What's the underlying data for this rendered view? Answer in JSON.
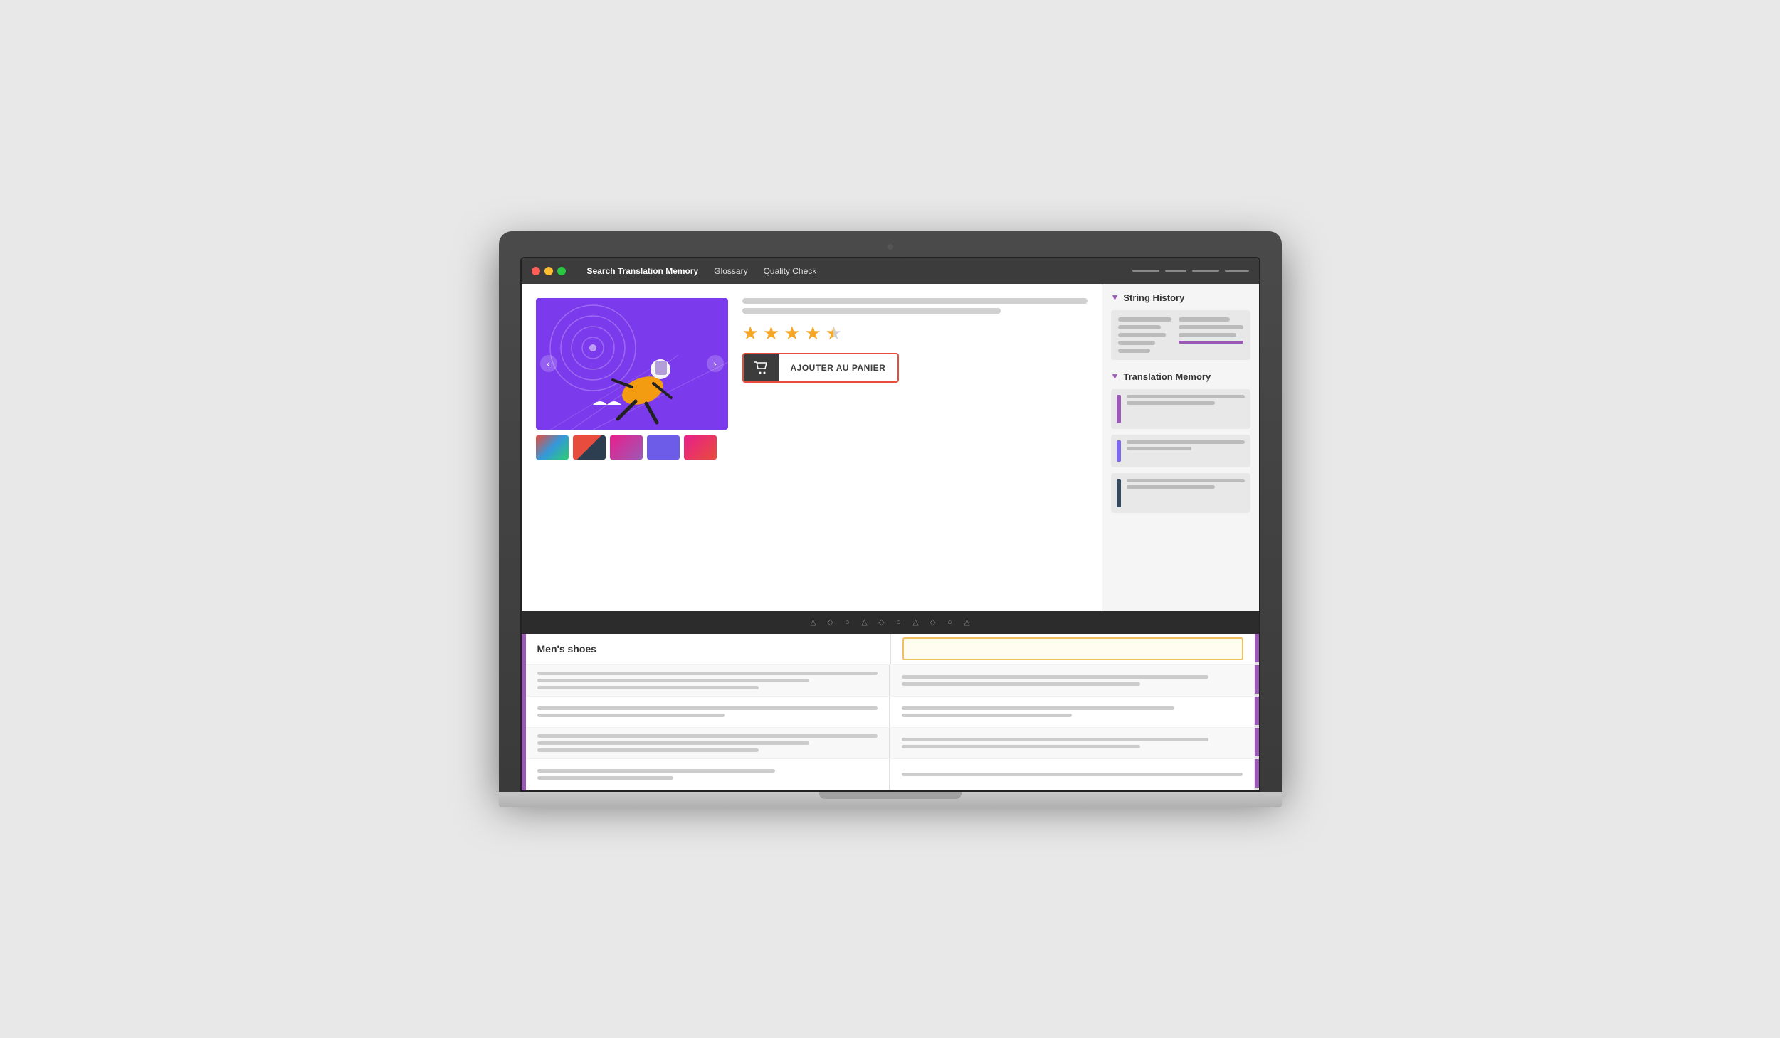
{
  "titleBar": {
    "trafficLights": [
      "red",
      "yellow",
      "green"
    ],
    "menuItems": [
      {
        "label": "Search Translation Memory",
        "active": true
      },
      {
        "label": "Glossary",
        "active": false
      },
      {
        "label": "Quality Check",
        "active": false
      }
    ]
  },
  "sidebar": {
    "stringHistory": {
      "title": "String History"
    },
    "translationMemory": {
      "title": "Translation Memory"
    }
  },
  "product": {
    "addToCartLabel": "AJOUTER AU PANIER",
    "stars": [
      true,
      true,
      true,
      true,
      false
    ]
  },
  "table": {
    "sourceHeader": "Men's shoes",
    "translationHeader": "",
    "rows": [
      {
        "source": "",
        "translation": ""
      },
      {
        "source": "",
        "translation": ""
      },
      {
        "source": "",
        "translation": ""
      },
      {
        "source": "",
        "translation": ""
      }
    ]
  },
  "toolbar": {
    "icons": [
      "△",
      "◇",
      "○",
      "△",
      "◇",
      "○",
      "△",
      "◇",
      "○",
      "△"
    ]
  }
}
